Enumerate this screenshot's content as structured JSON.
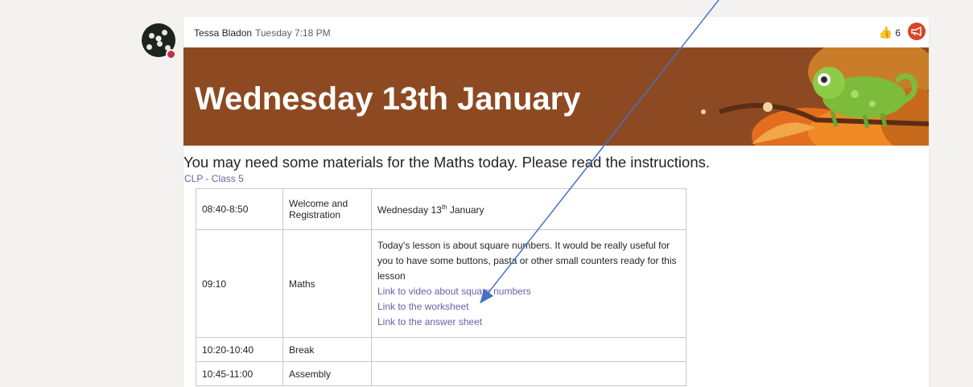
{
  "post": {
    "author": "Tessa Bladon",
    "time": "Tuesday 7:18 PM",
    "reaction_count": "6",
    "banner_title": "Wednesday 13th January",
    "subtitle": "You may need some materials for the Maths today. Please read the instructions.",
    "channel": "CLP - Class 5"
  },
  "schedule": {
    "rows": [
      {
        "time": "08:40-8:50",
        "activity": "Welcome and Registration",
        "details_prefix": "Wednesday 13",
        "details_sup": "th",
        "details_suffix": " January"
      },
      {
        "time": "09:10",
        "activity": "Maths",
        "details_text": "Today's lesson is about square numbers. It would be really useful for you to have some buttons, pasta or other small counters ready for this lesson",
        "links": [
          "Link to video about square numbers",
          "Link to the worksheet",
          "Link to the answer sheet"
        ]
      },
      {
        "time": "10:20-10:40",
        "activity": "Break"
      },
      {
        "time": "10:45-11:00",
        "activity": "Assembly"
      }
    ]
  },
  "icons": {
    "thumbs_up": "thumbs-up-icon",
    "announcement": "megaphone-icon",
    "presence": "presence-busy-icon"
  },
  "colors": {
    "banner": "#8d4a22",
    "link": "#6264a7",
    "announcement": "#d9452b",
    "presence": "#c4314b",
    "arrow": "#4472c4"
  }
}
